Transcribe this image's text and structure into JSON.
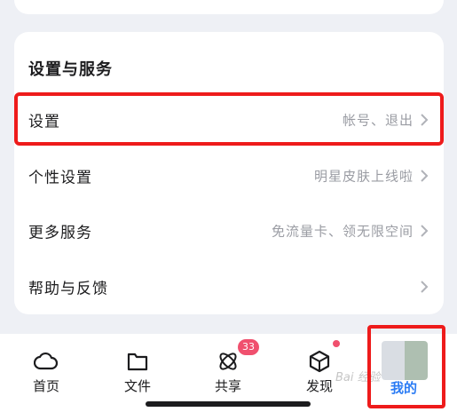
{
  "section": {
    "title": "设置与服务",
    "rows": [
      {
        "label": "设置",
        "hint": "帐号、退出"
      },
      {
        "label": "个性设置",
        "hint": "明星皮肤上线啦"
      },
      {
        "label": "更多服务",
        "hint": "免流量卡、领无限空间"
      },
      {
        "label": "帮助与反馈",
        "hint": ""
      }
    ]
  },
  "tabbar": {
    "tabs": [
      {
        "label": "首页",
        "icon": "cloud-icon"
      },
      {
        "label": "文件",
        "icon": "folder-icon"
      },
      {
        "label": "共享",
        "icon": "share-icon",
        "badge": "33"
      },
      {
        "label": "发现",
        "icon": "cube-icon"
      },
      {
        "label": "我的",
        "icon": "avatar-icon"
      }
    ]
  },
  "watermark": "Bai 经验",
  "colors": {
    "highlight": "#ee1b1b",
    "badge": "#f0506e",
    "active_tab": "#2a7bf4"
  }
}
